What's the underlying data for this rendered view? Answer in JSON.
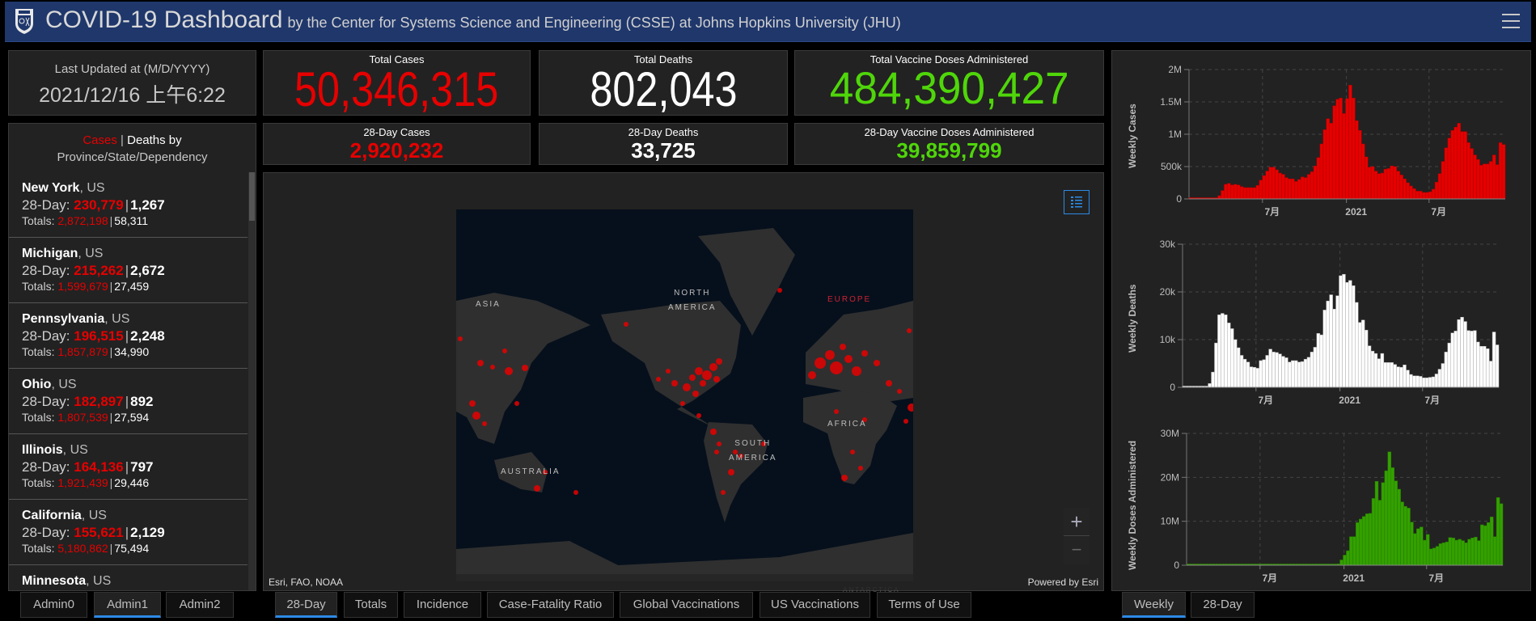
{
  "header": {
    "title": "COVID-19 Dashboard",
    "subtitle": "by the Center for Systems Science and Engineering (CSSE) at Johns Hopkins University (JHU)",
    "logo_icon": "jhu-shield-logo",
    "menu_icon": "hamburger-menu-icon",
    "color": "#1f376b"
  },
  "last_updated": {
    "label": "Last Updated at (M/D/YYYY)",
    "value": "2021/12/16 上午6:22"
  },
  "totals": {
    "cases": {
      "label": "Total Cases",
      "value": "50,346,315",
      "color": "#e60000"
    },
    "deaths": {
      "label": "Total Deaths",
      "value": "802,043",
      "color": "#ffffff"
    },
    "vaccines": {
      "label": "Total Vaccine Doses Administered",
      "value": "484,390,427",
      "color": "#4fd60a"
    },
    "cases_28": {
      "label": "28-Day Cases",
      "value": "2,920,232"
    },
    "deaths_28": {
      "label": "28-Day Deaths",
      "value": "33,725"
    },
    "vaccines_28": {
      "label": "28-Day Vaccine Doses Administered",
      "value": "39,859,799"
    }
  },
  "list": {
    "title_cases": "Cases",
    "title_sep": "|",
    "title_deaths": "Deaths by",
    "title_sub": "Province/State/Dependency",
    "day_label": "28-Day:",
    "totals_label": "Totals:",
    "items": [
      {
        "name": "New York",
        "country": ", US",
        "cases_28": "230,779",
        "deaths_28": "1,267",
        "cases_total": "2,872,198",
        "deaths_total": "58,311"
      },
      {
        "name": "Michigan",
        "country": ", US",
        "cases_28": "215,262",
        "deaths_28": "2,672",
        "cases_total": "1,599,679",
        "deaths_total": "27,459"
      },
      {
        "name": "Pennsylvania",
        "country": ", US",
        "cases_28": "196,515",
        "deaths_28": "2,248",
        "cases_total": "1,857,879",
        "deaths_total": "34,990"
      },
      {
        "name": "Ohio",
        "country": ", US",
        "cases_28": "182,897",
        "deaths_28": "892",
        "cases_total": "1,807,539",
        "deaths_total": "27,594"
      },
      {
        "name": "Illinois",
        "country": ", US",
        "cases_28": "164,136",
        "deaths_28": "797",
        "cases_total": "1,921,439",
        "deaths_total": "29,446"
      },
      {
        "name": "California",
        "country": ", US",
        "cases_28": "155,621",
        "deaths_28": "2,129",
        "cases_total": "5,180,862",
        "deaths_total": "75,494"
      },
      {
        "name": "Minnesota",
        "country": ", US"
      }
    ]
  },
  "map": {
    "labels": {
      "asia": "ASIA",
      "north_america_1": "NORTH",
      "north_america_2": "AMERICA",
      "europe": "EUROPE",
      "africa": "AFRICA",
      "south_america_1": "SOUTH",
      "south_america_2": "AMERICA",
      "australia": "AUSTRALIA",
      "antarctica": "ANTARCTICA"
    },
    "attribution": "Esri, FAO, NOAA",
    "powered_by": "Powered by Esri",
    "legend_icon": "legend-list-icon",
    "zoom_in": "+",
    "zoom_out": "−",
    "dot_color": "#e60000"
  },
  "left_tabs": [
    {
      "label": "Admin0",
      "active": false
    },
    {
      "label": "Admin1",
      "active": true
    },
    {
      "label": "Admin2",
      "active": false
    }
  ],
  "map_tabs": [
    {
      "label": "28-Day",
      "active": true
    },
    {
      "label": "Totals"
    },
    {
      "label": "Incidence"
    },
    {
      "label": "Case-Fatality Ratio"
    },
    {
      "label": "Global Vaccinations"
    },
    {
      "label": "US Vaccinations"
    },
    {
      "label": "Terms of Use"
    }
  ],
  "chart_tabs": [
    {
      "label": "Weekly",
      "active": true
    },
    {
      "label": "28-Day"
    }
  ],
  "chart_data": [
    {
      "type": "bar",
      "ylabel": "Weekly Cases",
      "xlabel": "",
      "interval": "weekly",
      "first_week": "2020-01-22",
      "ylim": [
        0,
        2000000
      ],
      "yticks": [
        "0",
        "500k",
        "1M",
        "1.5M",
        "2M"
      ],
      "grid": true,
      "color": "#e60000",
      "xticks": [
        {
          "label": "7月",
          "date": "2020-07-01"
        },
        {
          "label": "2021",
          "date": "2021-01-01"
        },
        {
          "label": "7月",
          "date": "2021-07-01"
        }
      ],
      "values": [
        0,
        0,
        0,
        0,
        0,
        0,
        0,
        1000,
        10000,
        50000,
        130000,
        225000,
        240000,
        215000,
        225000,
        215000,
        190000,
        175000,
        175000,
        175000,
        175000,
        210000,
        290000,
        360000,
        430000,
        490000,
        490000,
        450000,
        400000,
        380000,
        330000,
        310000,
        310000,
        270000,
        300000,
        340000,
        330000,
        380000,
        420000,
        510000,
        640000,
        850000,
        1070000,
        1240000,
        1170000,
        1440000,
        1540000,
        1560000,
        1320000,
        1550000,
        1760000,
        1560000,
        1210000,
        1060000,
        850000,
        650000,
        490000,
        500000,
        430000,
        390000,
        400000,
        460000,
        470000,
        510000,
        500000,
        430000,
        370000,
        310000,
        250000,
        200000,
        160000,
        120000,
        120000,
        100000,
        100000,
        110000,
        150000,
        260000,
        390000,
        580000,
        790000,
        940000,
        1060000,
        1110000,
        1170000,
        1040000,
        1040000,
        870000,
        780000,
        680000,
        610000,
        520000,
        540000,
        540000,
        580000,
        680000,
        530000,
        870000,
        840000
      ]
    },
    {
      "type": "bar",
      "ylabel": "Weekly Deaths",
      "xlabel": "",
      "interval": "weekly",
      "first_week": "2020-01-22",
      "ylim": [
        0,
        30000
      ],
      "yticks": [
        "0",
        "10k",
        "20k",
        "30k"
      ],
      "grid": true,
      "color": "#ffffff",
      "xticks": [
        {
          "label": "7月",
          "date": "2020-07-01"
        },
        {
          "label": "2021",
          "date": "2021-01-01"
        },
        {
          "label": "7月",
          "date": "2021-07-01"
        }
      ],
      "values": [
        0,
        0,
        0,
        0,
        0,
        0,
        0,
        0,
        800,
        3200,
        9300,
        15200,
        15500,
        15200,
        13500,
        12300,
        10000,
        8300,
        6700,
        5900,
        5300,
        4300,
        4200,
        4000,
        5600,
        5800,
        6700,
        8000,
        7400,
        7300,
        7000,
        6500,
        6200,
        5300,
        5600,
        5600,
        5300,
        5400,
        5900,
        6300,
        7400,
        8400,
        11300,
        11000,
        16200,
        18100,
        19400,
        16400,
        19200,
        23400,
        23700,
        22000,
        22400,
        21300,
        17800,
        13600,
        14100,
        12000,
        8700,
        7600,
        7100,
        6000,
        7100,
        5200,
        5200,
        5200,
        4800,
        4300,
        4200,
        4700,
        3600,
        2700,
        2400,
        2400,
        2300,
        2000,
        2000,
        2100,
        2200,
        2800,
        3800,
        5000,
        7400,
        9300,
        11400,
        11800,
        14200,
        14700,
        13800,
        11900,
        11800,
        11900,
        9500,
        8600,
        8600,
        8100,
        5500,
        11600,
        8900
      ]
    },
    {
      "type": "bar",
      "ylabel": "Weekly Doses Administered",
      "xlabel": "",
      "interval": "weekly",
      "first_week": "2020-01-22",
      "ylim": [
        0,
        30000000
      ],
      "yticks": [
        "0",
        "10M",
        "20M",
        "30M"
      ],
      "grid": true,
      "color": "#33a100",
      "xticks": [
        {
          "label": "7月",
          "date": "2020-07-01"
        },
        {
          "label": "2021",
          "date": "2021-01-01"
        },
        {
          "label": "7月",
          "date": "2021-07-01"
        }
      ],
      "values": [
        0,
        0,
        0,
        0,
        0,
        0,
        0,
        0,
        0,
        0,
        0,
        0,
        0,
        0,
        0,
        0,
        0,
        0,
        0,
        0,
        0,
        0,
        0,
        0,
        0,
        0,
        0,
        0,
        0,
        0,
        0,
        0,
        0,
        0,
        0,
        0,
        0,
        0,
        0,
        0,
        0,
        0,
        0,
        0,
        0,
        0,
        0,
        300000,
        1200000,
        2300000,
        3300000,
        6500000,
        6500000,
        9700000,
        10500000,
        11100000,
        11700000,
        11800000,
        15200000,
        19100000,
        14800000,
        18800000,
        21500000,
        25800000,
        22200000,
        19200000,
        17300000,
        14400000,
        13400000,
        13000000,
        9800000,
        7200000,
        8300000,
        8700000,
        5700000,
        7000000,
        3700000,
        3900000,
        4300000,
        4900000,
        5100000,
        5300000,
        6300000,
        6200000,
        5700000,
        5900000,
        5600000,
        5100000,
        5900000,
        6200000,
        6400000,
        5600000,
        9200000,
        9000000,
        9700000,
        11000000,
        6500000,
        15400000,
        14000000
      ]
    }
  ]
}
